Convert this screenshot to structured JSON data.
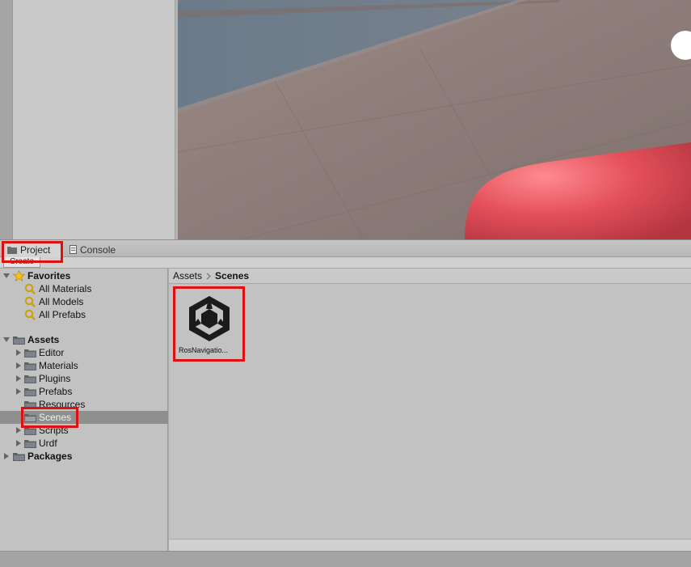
{
  "tabs": {
    "project_label": "Project",
    "console_label": "Console"
  },
  "toolbar": {
    "create_label": "Create"
  },
  "favorites": {
    "label": "Favorites",
    "items": [
      "All Materials",
      "All Models",
      "All Prefabs"
    ]
  },
  "assets_tree": {
    "label": "Assets",
    "items": [
      "Editor",
      "Materials",
      "Plugins",
      "Prefabs",
      "Resources",
      "Scenes",
      "Scripts",
      "Urdf"
    ],
    "selected": "Scenes"
  },
  "packages": {
    "label": "Packages"
  },
  "breadcrumb": {
    "root": "Assets",
    "current": "Scenes"
  },
  "asset_grid": {
    "items": [
      {
        "label": "RosNavigatio...",
        "icon": "unity-scene-icon"
      }
    ]
  },
  "colors": {
    "highlight": "#e01010",
    "selection": "#8f8f8f",
    "scene_floor": "#8b7c78",
    "scene_wall": "#6f7f90",
    "capsule": "#e0505a"
  }
}
